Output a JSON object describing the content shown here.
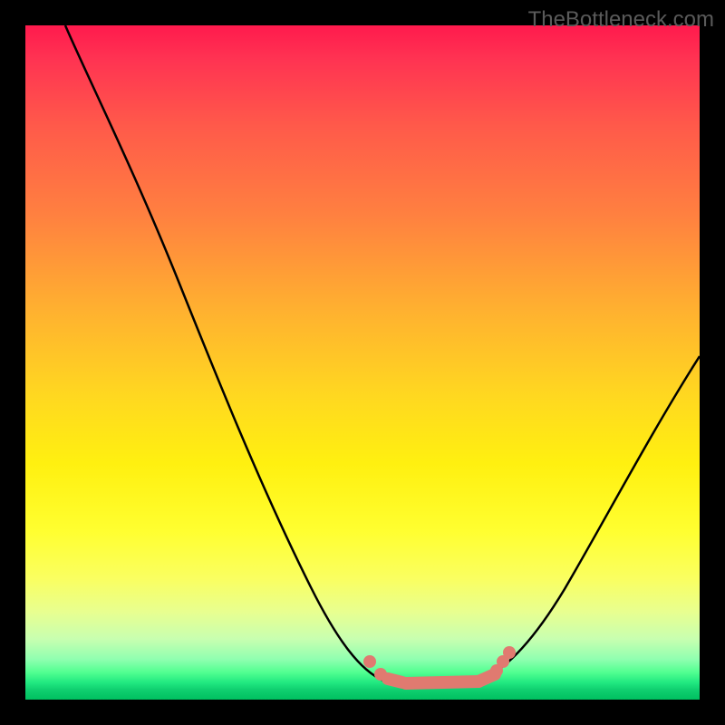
{
  "watermark": "TheBottleneck.com",
  "chart_data": {
    "type": "line",
    "title": "",
    "xlabel": "",
    "ylabel": "",
    "xlim": [
      0,
      100
    ],
    "ylim": [
      0,
      100
    ],
    "grid": false,
    "legend": false,
    "note": "Axes unlabeled; x normalized 0–100 left→right, y is bottleneck % (0 at bottom = no bottleneck, 100 at top = severe).",
    "background_gradient": {
      "top": "#ff1a4d",
      "upper_mid": "#ffb030",
      "mid": "#ffff30",
      "lower": "#20e880",
      "bottom": "#00c060"
    },
    "series": [
      {
        "name": "bottleneck-curve",
        "color": "#000000",
        "x": [
          6,
          12,
          20,
          28,
          36,
          44,
          50,
          53,
          56,
          60,
          64,
          68,
          72,
          78,
          85,
          92,
          100
        ],
        "y": [
          100,
          88,
          72,
          56,
          40,
          24,
          10,
          4,
          2,
          2,
          2,
          3,
          6,
          14,
          28,
          40,
          51
        ]
      },
      {
        "name": "optimal-range-markers",
        "color": "#e07a70",
        "x": [
          51,
          53,
          55,
          58,
          62,
          66,
          68,
          70,
          71,
          72
        ],
        "y": [
          6,
          4,
          3,
          2,
          2,
          2,
          3,
          4,
          5,
          7
        ]
      }
    ]
  }
}
